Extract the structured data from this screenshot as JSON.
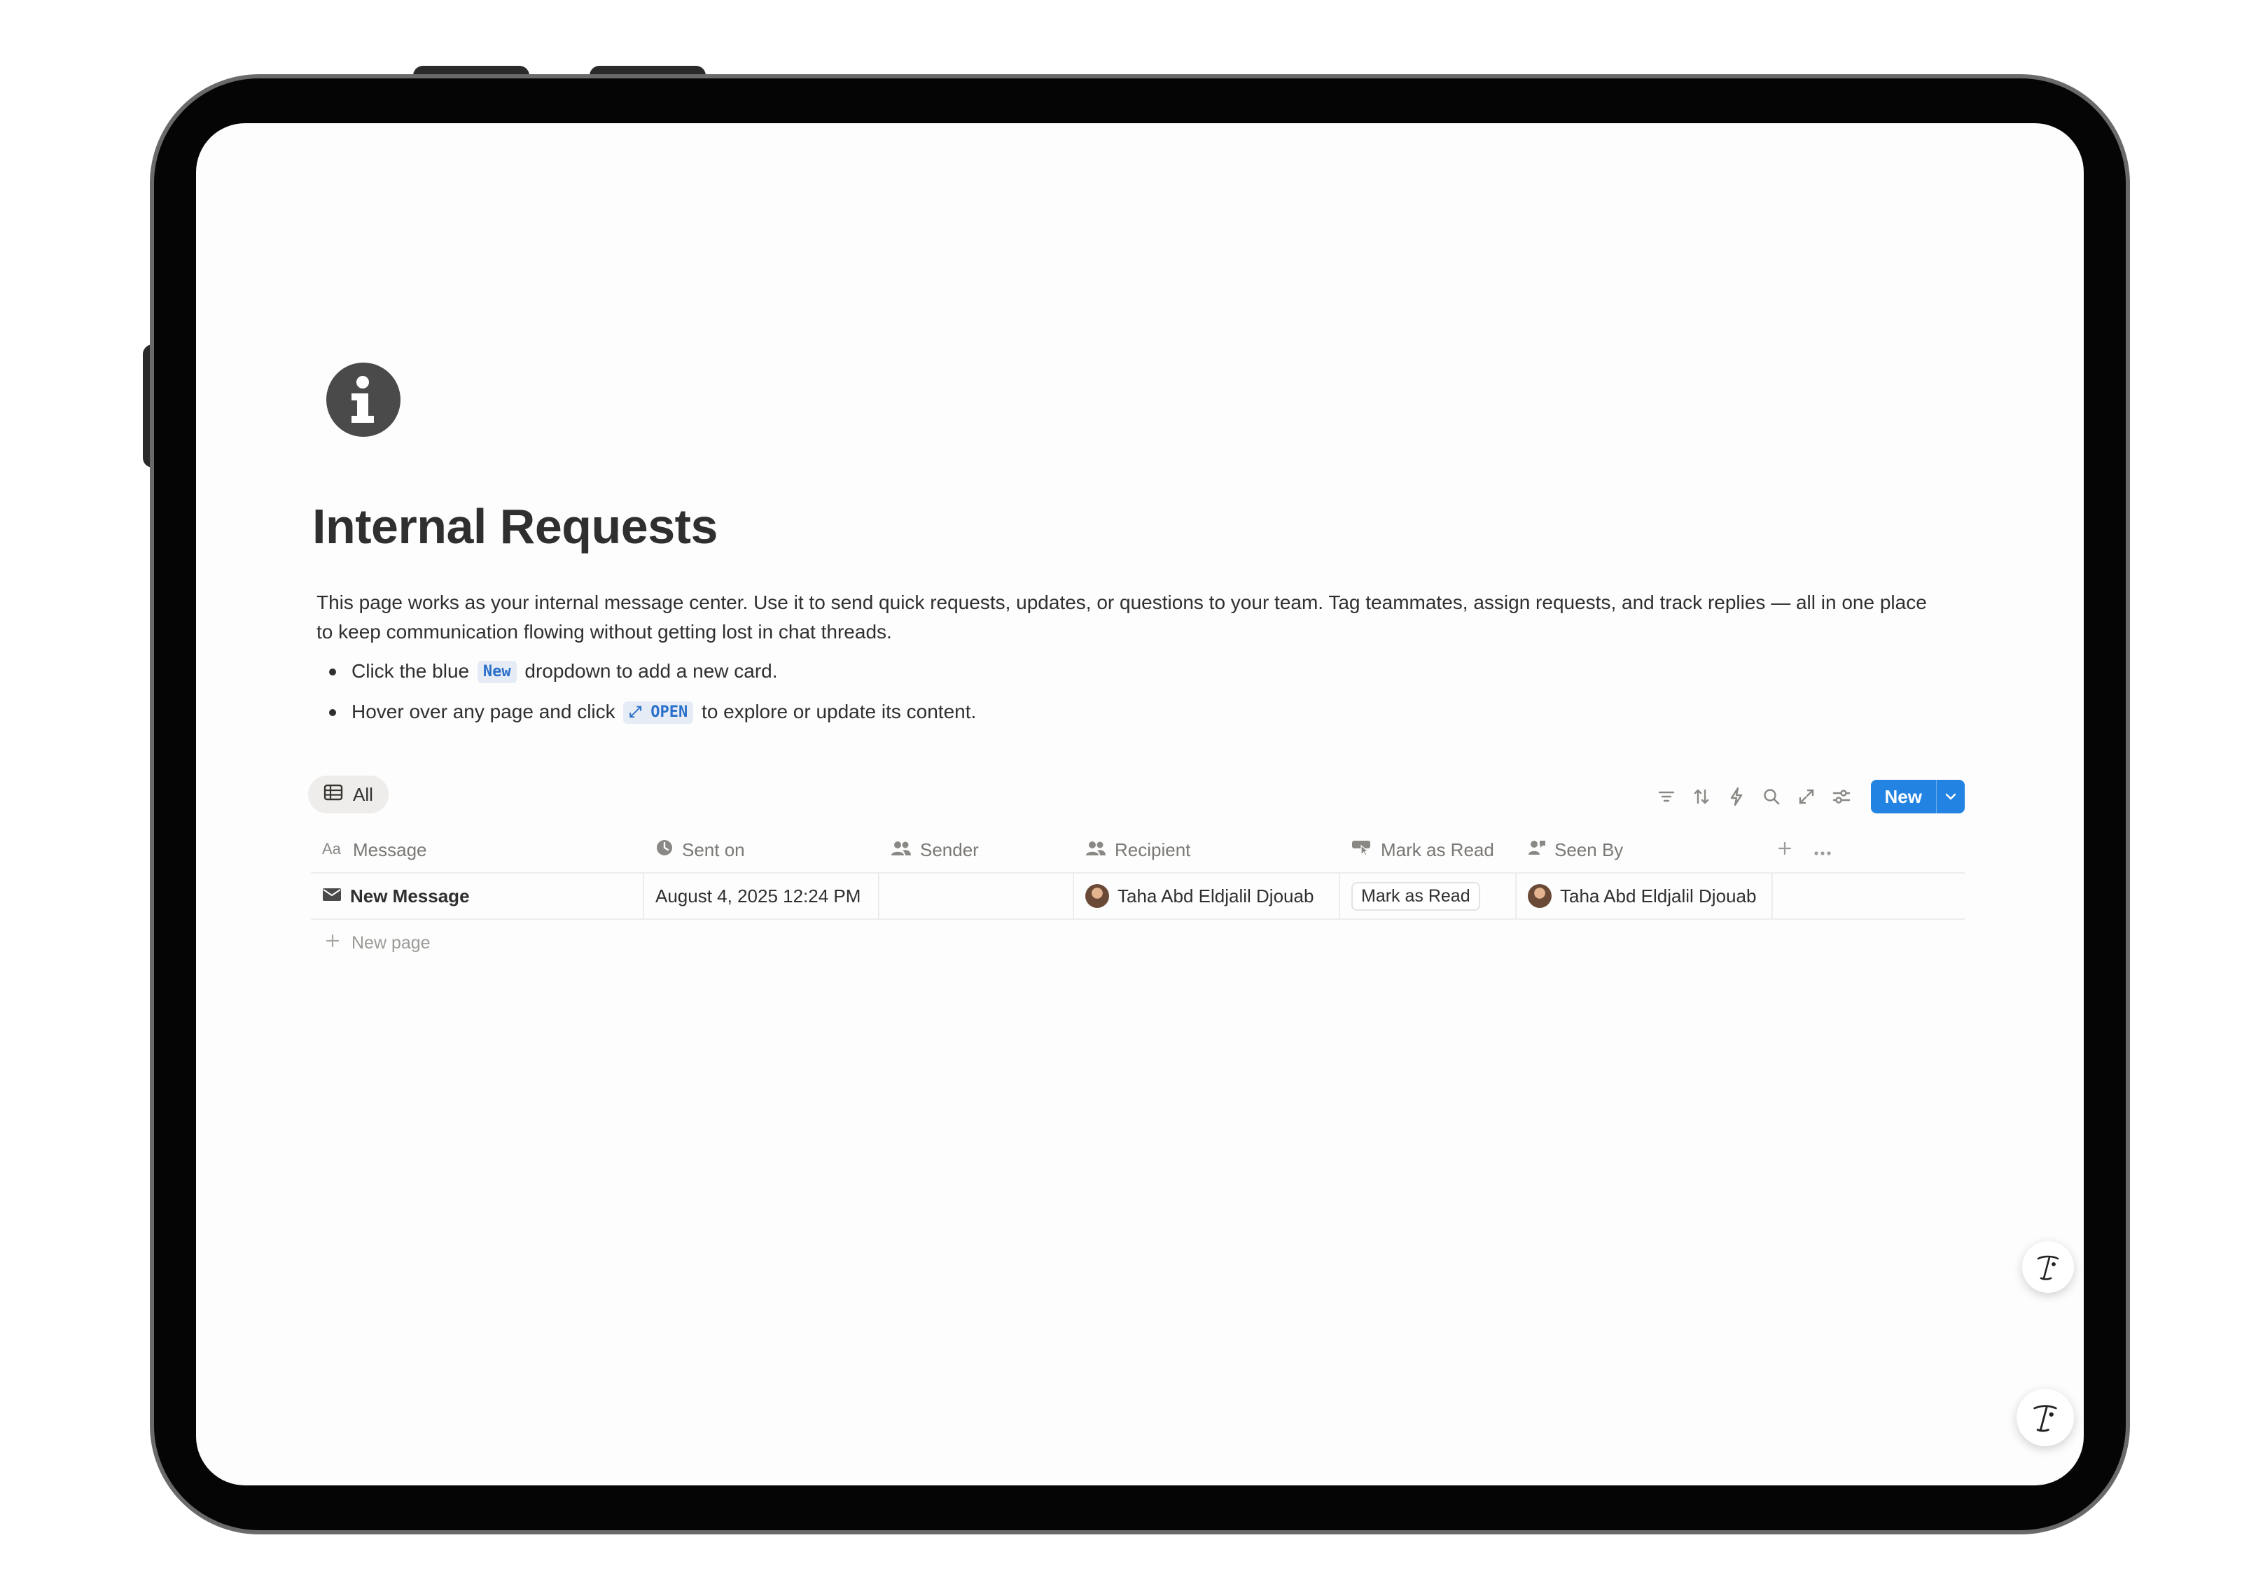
{
  "page": {
    "title": "Internal Requests",
    "icon": "info-circle-icon",
    "description": "This page works as your internal message center. Use it to send quick requests, updates, or questions to your team. Tag teammates, assign requests, and track replies — all in one place to keep communication flowing without getting lost in chat threads.",
    "bullets": [
      {
        "before": "Click the blue",
        "pill": "New",
        "after": "dropdown to add a new card."
      },
      {
        "before": "Hover over any page and click",
        "pill": "⤢ OPEN",
        "after": "to explore or update its content."
      }
    ]
  },
  "view": {
    "tab_label": "All",
    "tab_icon": "table-icon"
  },
  "toolbar": {
    "icons": [
      "filter-icon",
      "sort-icon",
      "automation-bolt-icon",
      "search-icon",
      "expand-icon",
      "settings-sliders-icon"
    ],
    "new_button_label": "New"
  },
  "table": {
    "columns": [
      {
        "label": "Message",
        "icon": "text-aa-icon"
      },
      {
        "label": "Sent on",
        "icon": "clock-icon"
      },
      {
        "label": "Sender",
        "icon": "people-icon"
      },
      {
        "label": "Recipient",
        "icon": "people-icon"
      },
      {
        "label": "Mark as Read",
        "icon": "button-click-icon"
      },
      {
        "label": "Seen By",
        "icon": "people-icon"
      }
    ],
    "rows": [
      {
        "message": "New Message",
        "message_icon": "envelope-icon",
        "sent_on": "August 4, 2025 12:24 PM",
        "sender": "",
        "recipient": "Taha Abd Eldjalil Djouab",
        "mark_as_read_button": "Mark as Read",
        "seen_by": "Taha Abd Eldjalil Djouab"
      }
    ],
    "new_page_label": "New page"
  },
  "colors": {
    "accent": "#2383e2",
    "text": "#2f2f2f",
    "muted": "#7a7874",
    "code_pill_bg": "#e6ecf6",
    "code_pill_text": "#2a6fc9"
  }
}
